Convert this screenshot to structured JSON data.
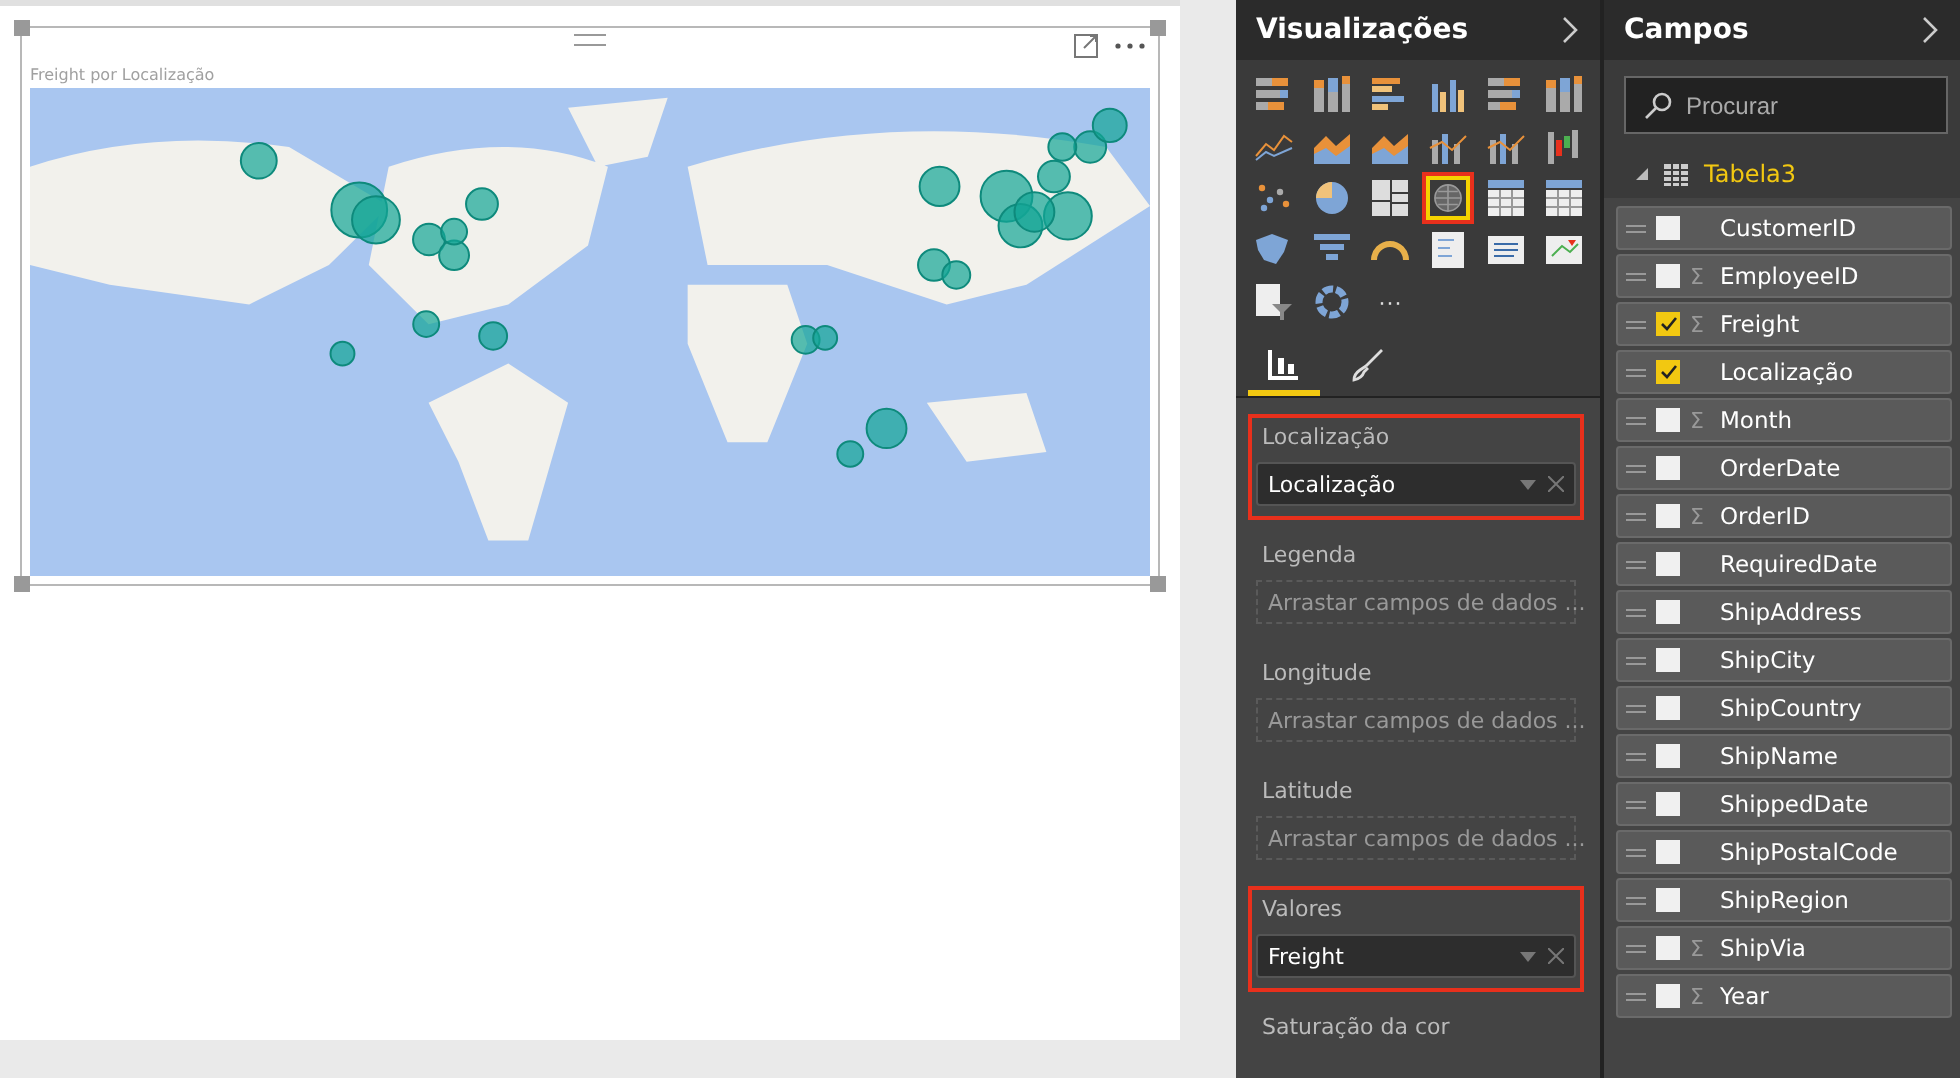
{
  "visual": {
    "title": "Freight por Localização"
  },
  "visualizations": {
    "title": "Visualizações",
    "icons": [
      {
        "kind": "stacked-bar",
        "selected": false
      },
      {
        "kind": "stacked-column",
        "selected": false
      },
      {
        "kind": "clustered-bar",
        "selected": false
      },
      {
        "kind": "clustered-column",
        "selected": false
      },
      {
        "kind": "stacked-bar",
        "selected": false
      },
      {
        "kind": "stacked-column",
        "selected": false
      },
      {
        "kind": "line",
        "selected": false
      },
      {
        "kind": "area",
        "selected": false
      },
      {
        "kind": "area",
        "selected": false
      },
      {
        "kind": "combo",
        "selected": false
      },
      {
        "kind": "combo",
        "selected": false
      },
      {
        "kind": "waterfall",
        "selected": false
      },
      {
        "kind": "scatter",
        "selected": false
      },
      {
        "kind": "pie",
        "selected": false
      },
      {
        "kind": "treemap",
        "selected": false
      },
      {
        "kind": "map",
        "selected": true
      },
      {
        "kind": "table",
        "selected": false
      },
      {
        "kind": "table",
        "selected": false
      },
      {
        "kind": "filled-map",
        "selected": false
      },
      {
        "kind": "funnel",
        "selected": false
      },
      {
        "kind": "gauge",
        "selected": false
      },
      {
        "kind": "slicer",
        "selected": false
      },
      {
        "kind": "card",
        "selected": false
      },
      {
        "kind": "kpi",
        "selected": false
      },
      {
        "kind": "filter",
        "selected": false
      },
      {
        "kind": "donut",
        "selected": false
      }
    ],
    "more": "···",
    "tabs": [
      {
        "kind": "fields",
        "selected": true
      },
      {
        "kind": "format",
        "selected": false
      }
    ],
    "wells": [
      {
        "label": "Localização",
        "highlighted": true,
        "field": "Localização"
      },
      {
        "label": "Legenda",
        "highlighted": false,
        "placeholder": "Arrastar campos de dados ..."
      },
      {
        "label": "Longitude",
        "highlighted": false,
        "placeholder": "Arrastar campos de dados ..."
      },
      {
        "label": "Latitude",
        "highlighted": false,
        "placeholder": "Arrastar campos de dados ..."
      },
      {
        "label": "Valores",
        "highlighted": true,
        "field": "Freight"
      },
      {
        "label": "Saturação da cor",
        "highlighted": false
      }
    ]
  },
  "fields": {
    "title": "Campos",
    "search": {
      "placeholder": "Procurar"
    },
    "table": "Tabela3",
    "items": [
      {
        "name": "CustomerID",
        "checked": false
      },
      {
        "name": "EmployeeID",
        "sigma": "Σ",
        "checked": false
      },
      {
        "name": "Freight",
        "sigma": "Σ",
        "checked": true
      },
      {
        "name": "Localização",
        "checked": true
      },
      {
        "name": "Month",
        "sigma": "Σ",
        "checked": false
      },
      {
        "name": "OrderDate",
        "checked": false
      },
      {
        "name": "OrderID",
        "sigma": "Σ",
        "checked": false
      },
      {
        "name": "RequiredDate",
        "checked": false
      },
      {
        "name": "ShipAddress",
        "checked": false
      },
      {
        "name": "ShipCity",
        "checked": false
      },
      {
        "name": "ShipCountry",
        "checked": false
      },
      {
        "name": "ShipName",
        "checked": false
      },
      {
        "name": "ShippedDate",
        "checked": false
      },
      {
        "name": "ShipPostalCode",
        "checked": false
      },
      {
        "name": "ShipRegion",
        "checked": false
      },
      {
        "name": "ShipVia",
        "sigma": "Σ",
        "checked": false
      },
      {
        "name": "Year",
        "sigma": "Σ",
        "checked": false
      }
    ]
  }
}
